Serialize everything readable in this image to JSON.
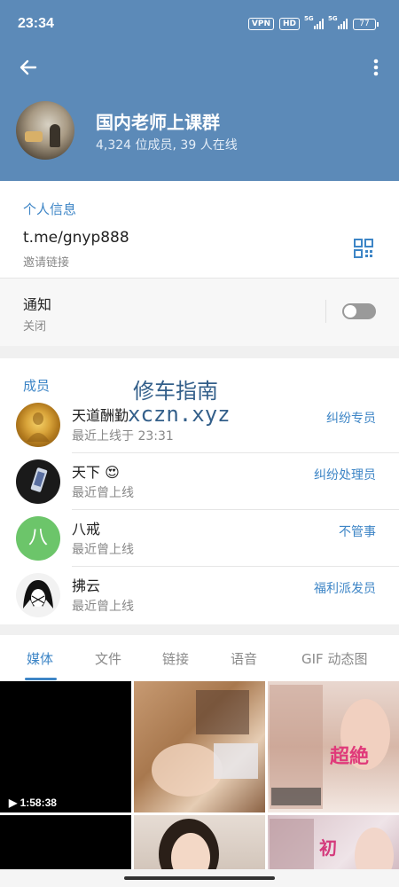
{
  "status_bar": {
    "time": "23:34",
    "vpn": "VPN",
    "hd": "HD",
    "signal1_label": "5G",
    "signal2_label": "5G",
    "battery": "77"
  },
  "header": {
    "back_icon": "back-arrow-icon",
    "more_icon": "more-vert-icon",
    "group_name": "国内老师上课群",
    "subtitle": "4,324 位成员, 39 人在线",
    "bg_color": "#5c8ab8"
  },
  "info": {
    "section_title": "个人信息",
    "link": "t.me/gnyp888",
    "link_label": "邀请链接",
    "qr_icon": "qr-code-icon"
  },
  "notifications": {
    "title": "通知",
    "state": "关闭",
    "enabled": false
  },
  "members": {
    "section_title": "成员",
    "items": [
      {
        "name": "天道酬勤",
        "status": "最近上线于 23:31",
        "role": "纠纷专员"
      },
      {
        "name": "天下 😍",
        "status": "最近曾上线",
        "role": "纠纷处理员"
      },
      {
        "name": "八戒",
        "status": "最近曾上线",
        "role": "不管事",
        "initial": "八"
      },
      {
        "name": "拂云",
        "status": "最近曾上线",
        "role": "福利派发员"
      }
    ]
  },
  "watermark": {
    "line1": "修车指南",
    "line2": "xczn.xyz"
  },
  "tabs": [
    {
      "label": "媒体",
      "active": true
    },
    {
      "label": "文件",
      "active": false
    },
    {
      "label": "链接",
      "active": false
    },
    {
      "label": "语音",
      "active": false
    },
    {
      "label": "GIF 动态图",
      "active": false
    }
  ],
  "media": {
    "video_duration": "1:58:38",
    "play_icon": "play-icon"
  },
  "colors": {
    "accent": "#3d85c6",
    "toggle_off": "#9a9a9a",
    "letter_avatar": "#6cc56a"
  }
}
